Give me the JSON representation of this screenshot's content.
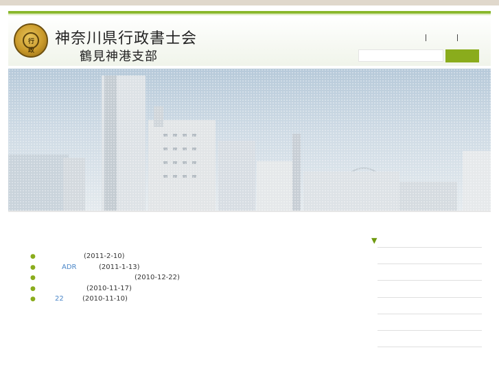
{
  "header": {
    "title_line1": "神奈川県行政書士会",
    "title_line2": "鶴見神港支部",
    "seal_mark": "行政"
  },
  "search": {
    "placeholder": ""
  },
  "news": [
    {
      "link": "",
      "date": "(2011-2-10)"
    },
    {
      "link": "ADR",
      "date": "(2011-1-13)"
    },
    {
      "link": "",
      "date": "(2010-12-22)"
    },
    {
      "link": "",
      "date": "(2010-11-17)"
    },
    {
      "link": "22",
      "date": "(2010-11-10)"
    }
  ],
  "sidebar": {
    "arrow": "▼"
  },
  "colors": {
    "accent": "#8aac1c",
    "link": "#4a86c8",
    "background": "#e0d8cc"
  }
}
